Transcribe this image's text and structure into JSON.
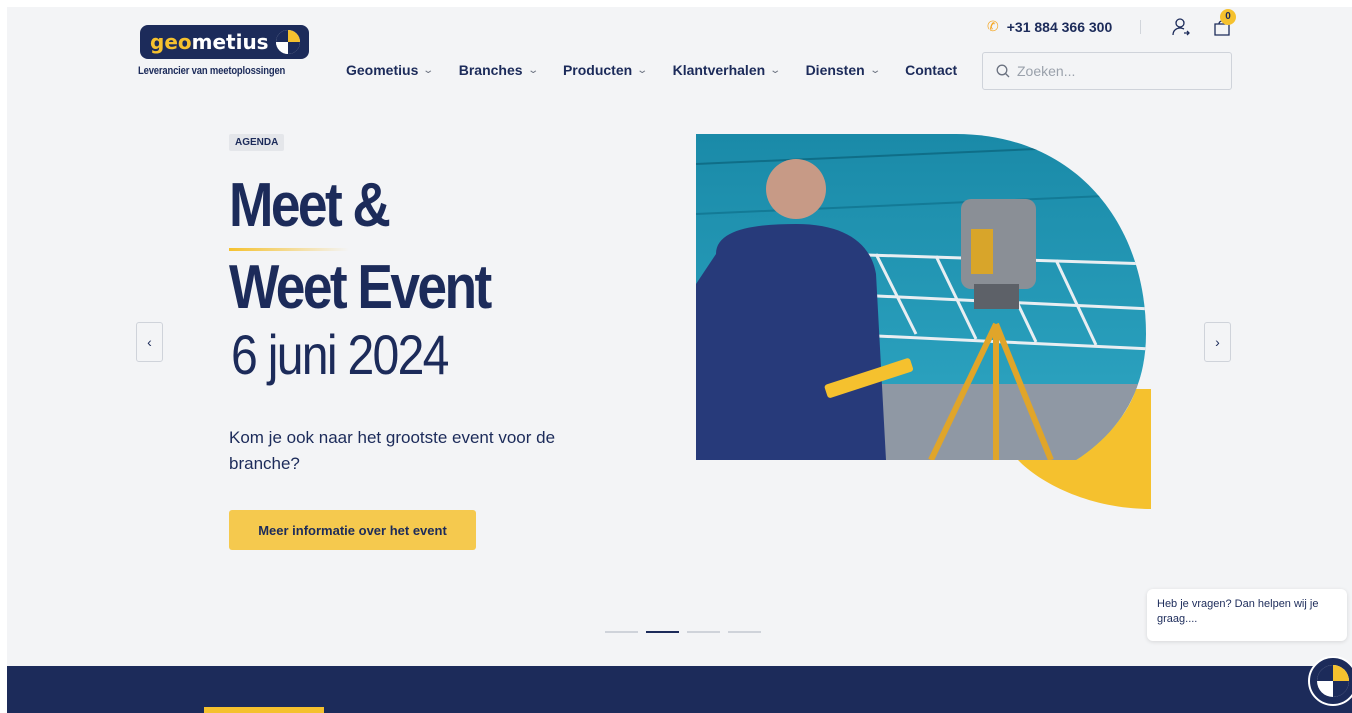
{
  "header": {
    "logo_text_accent": "geo",
    "logo_text": "metius",
    "tagline": "Leverancier van meetoplossingen",
    "phone": "+31 884 366 300",
    "cart_count": "0",
    "search_placeholder": "Zoeken...",
    "nav": [
      {
        "label": "Geometius",
        "dropdown": true
      },
      {
        "label": "Branches",
        "dropdown": true
      },
      {
        "label": "Producten",
        "dropdown": true
      },
      {
        "label": "Klantverhalen",
        "dropdown": true
      },
      {
        "label": "Diensten",
        "dropdown": true
      },
      {
        "label": "Contact",
        "dropdown": false
      }
    ]
  },
  "hero": {
    "badge": "AGENDA",
    "title_line1": "Meet &",
    "title_line2": "Weet Event",
    "date": "6 juni 2024",
    "lead": "Kom je ook naar het grootste event voor de branche?",
    "cta": "Meer informatie over het event",
    "slide_count": 4,
    "active_slide": 2
  },
  "chat": {
    "message": "Heb je vragen? Dan helpen wij je graag...."
  },
  "colors": {
    "navy": "#1c2b5a",
    "yellow": "#f5c12e",
    "background": "#f3f4f6"
  },
  "icons": {
    "phone": "phone-icon",
    "user": "user-icon",
    "cart": "cart-icon",
    "search": "search-icon",
    "prev": "chevron-left-icon",
    "next": "chevron-right-icon"
  }
}
